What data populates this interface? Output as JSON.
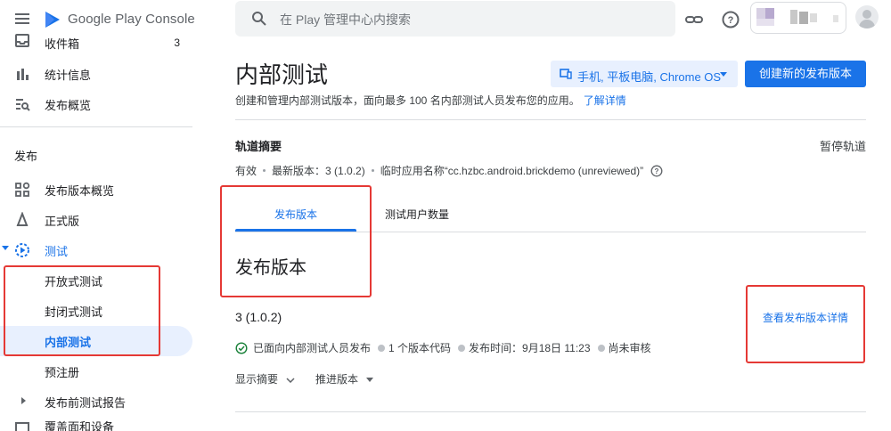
{
  "header": {
    "app_name": "Google Play Console",
    "search_placeholder": "在 Play 管理中心内搜索"
  },
  "sidebar": {
    "items_top": [
      {
        "label": "收件箱",
        "count": "3"
      },
      {
        "label": "统计信息"
      },
      {
        "label": "发布概览"
      }
    ],
    "section_release": "发布",
    "items_release": [
      {
        "label": "发布版本概览"
      },
      {
        "label": "正式版"
      },
      {
        "label": "测试"
      }
    ],
    "testing_sub": [
      {
        "label": "开放式测试"
      },
      {
        "label": "封闭式测试"
      },
      {
        "label": "内部测试"
      }
    ],
    "items_after": [
      {
        "label": "预注册"
      },
      {
        "label": "发布前测试报告"
      },
      {
        "label": "覆盖面和设备"
      }
    ]
  },
  "main": {
    "title": "内部测试",
    "device_button": "手机, 平板电脑, Chrome OS",
    "create_button": "创建新的发布版本",
    "description": "创建和管理内部测试版本，面向最多 100 名内部测试人员发布您的应用。",
    "learn_more": "了解详情",
    "track_summary": "轨道摘要",
    "pause_track": "暂停轨道",
    "track_status": {
      "state": "有效",
      "latest_release": "最新版本：3 (1.0.2)",
      "temp_name": "临时应用名称“cc.hzbc.android.brickdemo (unreviewed)”"
    },
    "tabs": [
      "发布版本",
      "测试用户数量"
    ],
    "section_title": "发布版本",
    "release": {
      "name": "3 (1.0.2)",
      "view_details": "查看发布版本详情",
      "status": "已面向内部测试人员发布",
      "version_codes": "1 个版本代码",
      "release_time": "发布时间：9月18日 11:23",
      "review": "尚未审核"
    },
    "actions": [
      "显示摘要",
      "推进版本"
    ]
  },
  "colors": {
    "accent": "#1a73e8",
    "highlight": "#e53935"
  }
}
